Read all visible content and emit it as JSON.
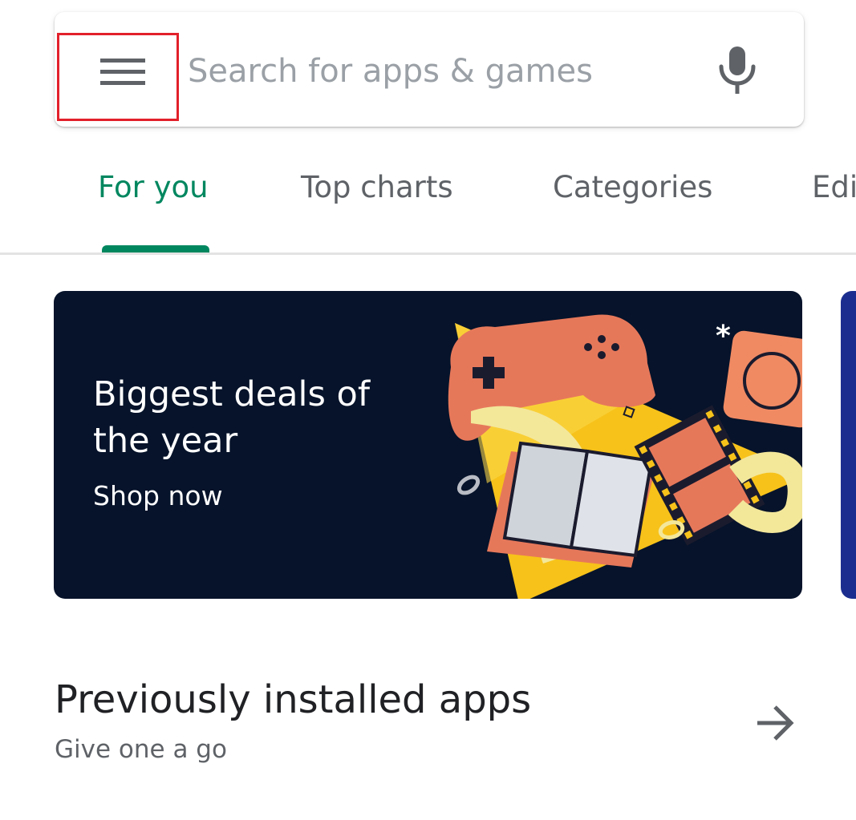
{
  "search": {
    "placeholder": "Search for apps & games",
    "menu_icon": "menu-hamburger-icon",
    "mic_icon": "microphone-icon",
    "highlight_color": "#e2202a"
  },
  "tabs": [
    {
      "label": "For you",
      "active": true
    },
    {
      "label": "Top charts",
      "active": false
    },
    {
      "label": "Categories",
      "active": false
    },
    {
      "label": "Edi",
      "active": false
    }
  ],
  "banner": {
    "title": "Biggest deals of the year",
    "cta": "Shop now"
  },
  "section": {
    "title": "Previously installed apps",
    "subtitle": "Give one a go",
    "arrow_icon": "arrow-right-icon"
  },
  "colors": {
    "accent": "#01875f",
    "banner_background": "#06132a",
    "text_primary": "#202124",
    "text_secondary": "#5f6368"
  }
}
